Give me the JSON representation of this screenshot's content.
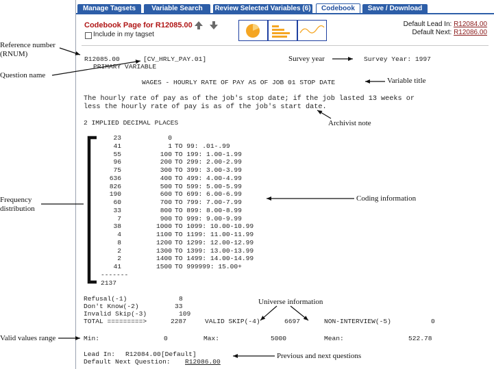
{
  "tabs": [
    {
      "label": "Manage Tagsets",
      "active": false
    },
    {
      "label": "Variable Search",
      "active": false
    },
    {
      "label": "Review Selected Variables (6)",
      "active": false
    },
    {
      "label": "Codebook",
      "active": true
    },
    {
      "label": "Save / Download",
      "active": false
    }
  ],
  "header": {
    "title": "Codebook Page for R12085.00",
    "tagset_label": "Include in my tagset",
    "tagset_checked": false,
    "default_lead_in_label": "Default Lead In:",
    "default_lead_in": "R12084.00",
    "default_next_label": "Default Next:",
    "default_next": "R12086.00"
  },
  "icons": [
    "arrow-up-icon",
    "arrow-down-icon",
    "pie-chart-icon",
    "bar-chart-icon",
    "line-chart-icon"
  ],
  "codebook": {
    "rnum": "R12085.00",
    "question_name": "[CV_HRLY_PAY.01]",
    "survey_year": "Survey Year: 1997",
    "primary": "PRIMARY VARIABLE",
    "title": "WAGES - HOURLY RATE OF PAY AS OF JOB 01 STOP DATE",
    "description_1": "The hourly rate of pay as of the job's stop date; if the job lasted 13 weeks or",
    "description_2": "less the hourly rate of pay is as of the job's start date.",
    "archivist_note": "2 IMPLIED DECIMAL PLACES",
    "freq": [
      {
        "count": "23",
        "code": "0",
        "desc": ""
      },
      {
        "count": "41",
        "code": "1",
        "desc": "TO 99: .01-.99"
      },
      {
        "count": "55",
        "code": "100",
        "desc": "TO 199: 1.00-1.99"
      },
      {
        "count": "96",
        "code": "200",
        "desc": "TO 299: 2.00-2.99"
      },
      {
        "count": "75",
        "code": "300",
        "desc": "TO 399: 3.00-3.99"
      },
      {
        "count": "636",
        "code": "400",
        "desc": "TO 499: 4.00-4.99"
      },
      {
        "count": "826",
        "code": "500",
        "desc": "TO 599: 5.00-5.99"
      },
      {
        "count": "190",
        "code": "600",
        "desc": "TO 699: 6.00-6.99"
      },
      {
        "count": "60",
        "code": "700",
        "desc": "TO 799: 7.00-7.99"
      },
      {
        "count": "33",
        "code": "800",
        "desc": "TO 899: 8.00-8.99"
      },
      {
        "count": "7",
        "code": "900",
        "desc": "TO 999: 9.00-9.99"
      },
      {
        "count": "38",
        "code": "1000",
        "desc": "TO 1099: 10.00-10.99"
      },
      {
        "count": "4",
        "code": "1100",
        "desc": "TO 1199: 11.00-11.99"
      },
      {
        "count": "8",
        "code": "1200",
        "desc": "TO 1299: 12.00-12.99"
      },
      {
        "count": "2",
        "code": "1300",
        "desc": "TO 1399: 13.00-13.99"
      },
      {
        "count": "2",
        "code": "1400",
        "desc": "TO 1499: 14.00-14.99"
      },
      {
        "count": "41",
        "code": "1500",
        "desc": "TO 999999: 15.00+"
      }
    ],
    "dashes": "-------",
    "total_count": "2137",
    "refusal_label": "Refusal(-1)",
    "refusal_value": "8",
    "dont_know_label": "Don't Know(-2)",
    "dont_know_value": "33",
    "invalid_skip_label": "Invalid Skip(-3)",
    "invalid_skip_value": "109",
    "total_label": "TOTAL =========>",
    "total_value": "2287",
    "valid_skip_label": "VALID SKIP(-4)",
    "valid_skip_value": "6697",
    "non_interview_label": "NON-INTERVIEW(-5)",
    "non_interview_value": "0",
    "min_label": "Min:",
    "min_value": "0",
    "max_label": "Max:",
    "max_value": "5000",
    "mean_label": "Mean:",
    "mean_value": "522.78",
    "lead_in_label": "Lead In:",
    "lead_in_value": "R12084.00[Default]",
    "next_question_label": "Default Next Question:",
    "next_question_value": "R12086.00"
  },
  "annotations": {
    "rnum": "Reference number\n(RNUM)",
    "question_name": "Question name",
    "survey_year": "Survey year",
    "variable_title": "Variable title",
    "archivist_note": "Archivist note",
    "frequency": "Frequency\ndistribution",
    "coding": "Coding information",
    "universe": "Universe information",
    "valid_range": "Valid values range",
    "prev_next": "Previous and next questions"
  },
  "colors": {
    "tab_bg": "#2d5ea8",
    "title_red": "#b01515",
    "link": "#8a1a1a",
    "chart_orange": "#f5a623",
    "chart_border": "#1d3fa0"
  }
}
